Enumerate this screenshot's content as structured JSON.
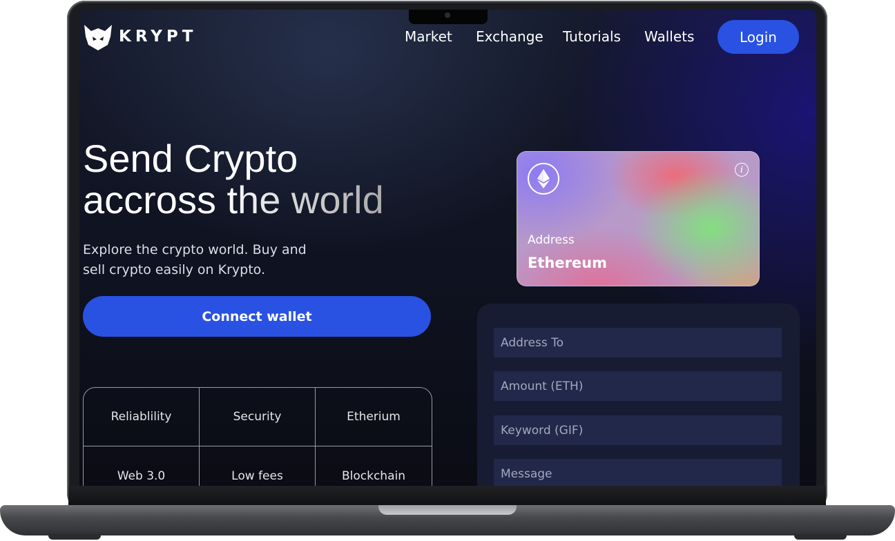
{
  "brand": {
    "name": "KRYPT"
  },
  "nav": {
    "items": [
      {
        "label": "Market"
      },
      {
        "label": "Exchange"
      },
      {
        "label": "Tutorials"
      },
      {
        "label": "Wallets"
      }
    ],
    "login_label": "Login"
  },
  "hero": {
    "title_line1": "Send Crypto",
    "title_line2": "accross the world",
    "subtitle": "Explore the crypto world. Buy and sell crypto easily on Krypto.",
    "connect_label": "Connect wallet"
  },
  "features": [
    "Reliablility",
    "Security",
    "Etherium",
    "Web 3.0",
    "Low fees",
    "Blockchain"
  ],
  "card": {
    "icon": "ethereum-icon",
    "info_icon": "info-icon",
    "address_label": "Address",
    "network": "Ethereum"
  },
  "form": {
    "address_placeholder": "Address To",
    "amount_placeholder": "Amount (ETH)",
    "keyword_placeholder": "Keyword (GIF)",
    "message_placeholder": "Message"
  },
  "colors": {
    "accent": "#2952e3",
    "background": "#0f1220",
    "form_panel": "#181c33",
    "input": "#22284a"
  }
}
